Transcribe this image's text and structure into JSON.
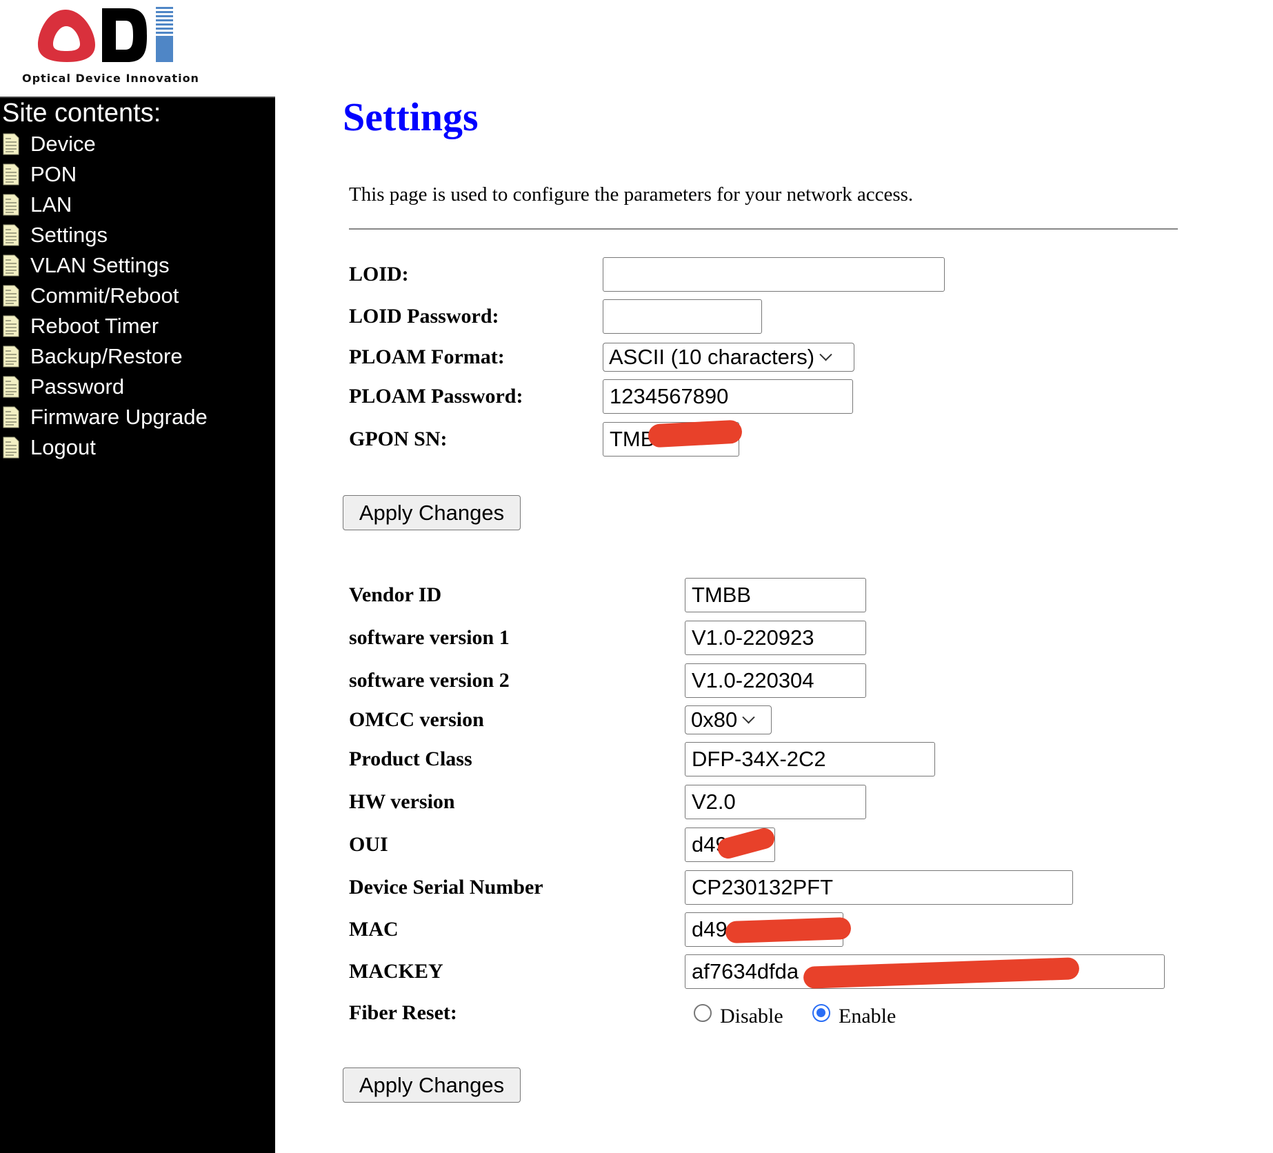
{
  "logo": {
    "text": "ODI",
    "subtitle": "Optical Device Innovation",
    "colors": {
      "o": "#d9303c",
      "d": "#000000",
      "i": "#4f86c6"
    }
  },
  "sidebar": {
    "title": "Site contents:",
    "icon": "document-icon",
    "items": [
      {
        "label": "Device"
      },
      {
        "label": "PON"
      },
      {
        "label": "LAN"
      },
      {
        "label": "Settings"
      },
      {
        "label": "VLAN Settings"
      },
      {
        "label": "Commit/Reboot"
      },
      {
        "label": "Reboot Timer"
      },
      {
        "label": "Backup/Restore"
      },
      {
        "label": "Password"
      },
      {
        "label": "Firmware Upgrade"
      },
      {
        "label": "Logout"
      }
    ]
  },
  "main": {
    "title": "Settings",
    "title_color": "#0000ff",
    "description": "This page is used to configure the parameters for your network access.",
    "form1": {
      "loid": {
        "label": "LOID:",
        "value": ""
      },
      "loid_password": {
        "label": "LOID Password:",
        "value": ""
      },
      "ploam_format": {
        "label": "PLOAM Format:",
        "value": "ASCII (10 characters)"
      },
      "ploam_password": {
        "label": "PLOAM Password:",
        "value": "1234567890"
      },
      "gpon_sn": {
        "label": "GPON SN:",
        "value": "TMB"
      },
      "apply_label": "Apply Changes"
    },
    "form2": {
      "vendor_id": {
        "label": "Vendor ID",
        "value": "TMBB"
      },
      "sw1": {
        "label": "software version 1",
        "value": "V1.0-220923"
      },
      "sw2": {
        "label": "software version 2",
        "value": "V1.0-220304"
      },
      "omcc": {
        "label": "OMCC version",
        "value": "0x80"
      },
      "product_class": {
        "label": "Product Class",
        "value": "DFP-34X-2C2"
      },
      "hw_version": {
        "label": "HW version",
        "value": "V2.0"
      },
      "oui": {
        "label": "OUI",
        "value": "d49"
      },
      "dsn": {
        "label": "Device Serial Number",
        "value": "CP230132PFT"
      },
      "mac": {
        "label": "MAC",
        "value": "d49"
      },
      "mackey": {
        "label": "MACKEY",
        "value": "af7634dfda"
      },
      "fiber_reset": {
        "label": "Fiber Reset:",
        "options": [
          "Disable",
          "Enable"
        ],
        "selected": "Enable"
      },
      "apply_label": "Apply Changes"
    },
    "redaction_color": "#e8412a"
  }
}
